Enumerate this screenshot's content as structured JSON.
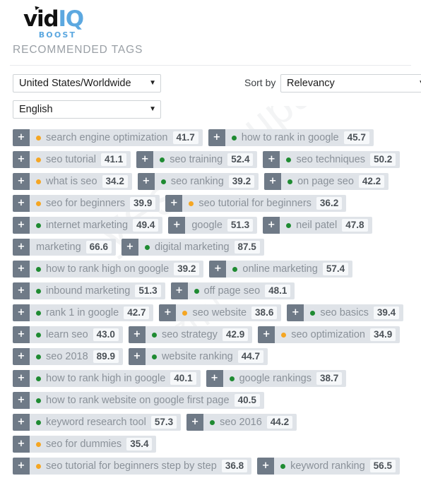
{
  "brand": {
    "name_part1": "vid",
    "name_part2": "IQ",
    "tagline": "BOOST",
    "color_primary": "#5ca8e0",
    "color_dark": "#111111"
  },
  "watermark": {
    "line1": "upa",
    "line2": "yes",
    "line3": "zhu"
  },
  "section": {
    "title": "RECOMMENDED TAGS"
  },
  "controls": {
    "country_select": {
      "value": "United States/Worldwide",
      "caret": "chevron-down-icon"
    },
    "language_select": {
      "value": "English",
      "caret": "chevron-down-icon"
    },
    "sort_label": "Sort by",
    "sort_select": {
      "value": "Relevancy",
      "caret": "chevron-down-icon"
    }
  },
  "tags": {
    "add_label": "+",
    "dot_colors": {
      "orange": "#f5a623",
      "green": "#1f8b32"
    },
    "rows": [
      [
        {
          "label": "search engine optimization",
          "score": "41.7",
          "dot": "orange"
        },
        {
          "label": "how to rank in google",
          "score": "45.7",
          "dot": "green"
        }
      ],
      [
        {
          "label": "seo tutorial",
          "score": "41.1",
          "dot": "orange"
        },
        {
          "label": "seo training",
          "score": "52.4",
          "dot": "green"
        },
        {
          "label": "seo techniques",
          "score": "50.2",
          "dot": "green"
        }
      ],
      [
        {
          "label": "what is seo",
          "score": "34.2",
          "dot": "orange"
        },
        {
          "label": "seo ranking",
          "score": "39.2",
          "dot": "green"
        },
        {
          "label": "on page seo",
          "score": "42.2",
          "dot": "green"
        }
      ],
      [
        {
          "label": "seo for beginners",
          "score": "39.9",
          "dot": "orange"
        },
        {
          "label": "seo tutorial for beginners",
          "score": "36.2",
          "dot": "orange"
        }
      ],
      [
        {
          "label": "internet marketing",
          "score": "49.4",
          "dot": "green"
        },
        {
          "label": "google",
          "score": "51.3",
          "dot": "none"
        },
        {
          "label": "neil patel",
          "score": "47.8",
          "dot": "green"
        }
      ],
      [
        {
          "label": "marketing",
          "score": "66.6",
          "dot": "none"
        },
        {
          "label": "digital marketing",
          "score": "87.5",
          "dot": "green"
        }
      ],
      [
        {
          "label": "how to rank high on google",
          "score": "39.2",
          "dot": "green"
        },
        {
          "label": "online marketing",
          "score": "57.4",
          "dot": "green"
        }
      ],
      [
        {
          "label": "inbound marketing",
          "score": "51.3",
          "dot": "green"
        },
        {
          "label": "off page seo",
          "score": "48.1",
          "dot": "green"
        }
      ],
      [
        {
          "label": "rank 1 in google",
          "score": "42.7",
          "dot": "green"
        },
        {
          "label": "seo website",
          "score": "38.6",
          "dot": "orange"
        },
        {
          "label": "seo basics",
          "score": "39.4",
          "dot": "green"
        }
      ],
      [
        {
          "label": "learn seo",
          "score": "43.0",
          "dot": "green"
        },
        {
          "label": "seo strategy",
          "score": "42.9",
          "dot": "green"
        },
        {
          "label": "seo optimization",
          "score": "34.9",
          "dot": "orange"
        }
      ],
      [
        {
          "label": "seo 2018",
          "score": "89.9",
          "dot": "green"
        },
        {
          "label": "website ranking",
          "score": "44.7",
          "dot": "green"
        }
      ],
      [
        {
          "label": "how to rank high in google",
          "score": "40.1",
          "dot": "green"
        },
        {
          "label": "google rankings",
          "score": "38.7",
          "dot": "green"
        }
      ],
      [
        {
          "label": "how to rank website on google first page",
          "score": "40.5",
          "dot": "green"
        }
      ],
      [
        {
          "label": "keyword research tool",
          "score": "57.3",
          "dot": "green"
        },
        {
          "label": "seo 2016",
          "score": "44.2",
          "dot": "green"
        }
      ],
      [
        {
          "label": "seo for dummies",
          "score": "35.4",
          "dot": "orange"
        }
      ],
      [
        {
          "label": "seo tutorial for beginners step by step",
          "score": "36.8",
          "dot": "orange"
        },
        {
          "label": "keyword ranking",
          "score": "56.5",
          "dot": "green"
        }
      ]
    ]
  }
}
